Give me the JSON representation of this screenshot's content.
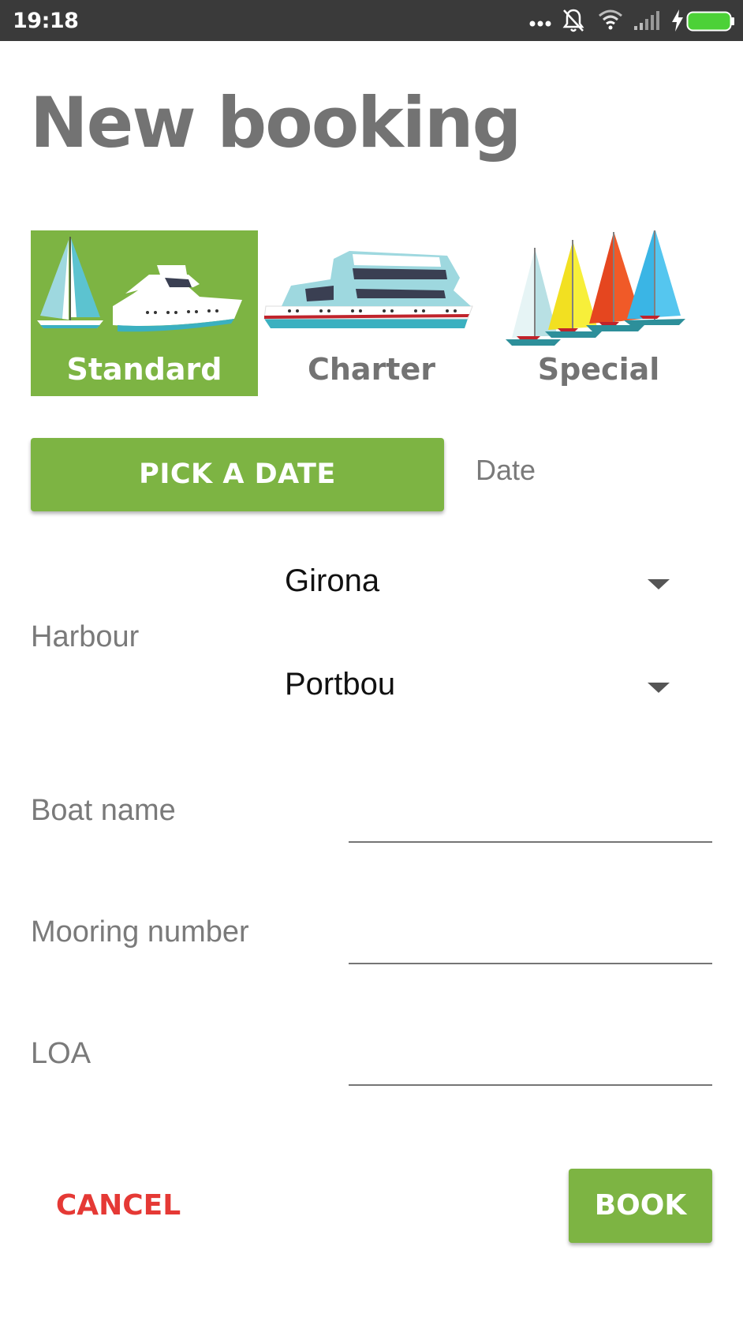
{
  "status_bar": {
    "time": "19:18",
    "icons": [
      "more-dots-icon",
      "bell-off-icon",
      "wifi-icon",
      "signal-icon",
      "charging-icon",
      "battery-icon"
    ],
    "battery_color": "#4cd137"
  },
  "title": "New booking",
  "booking_types": [
    {
      "label": "Standard",
      "icon": "sailboat-and-yacht-icon",
      "selected": true
    },
    {
      "label": "Charter",
      "icon": "charter-yacht-icon",
      "selected": false
    },
    {
      "label": "Special",
      "icon": "colorful-sailboats-icon",
      "selected": false
    }
  ],
  "date": {
    "pick_label": "PICK A DATE",
    "value_label": "Date"
  },
  "harbour": {
    "label": "Harbour",
    "region": "Girona",
    "port": "Portbou"
  },
  "fields": {
    "boat_name": {
      "label": "Boat name",
      "value": ""
    },
    "mooring_number": {
      "label": "Mooring number",
      "value": ""
    },
    "loa": {
      "label": "LOA",
      "value": ""
    }
  },
  "actions": {
    "cancel_label": "CANCEL",
    "book_label": "BOOK"
  },
  "colors": {
    "accent": "#7db443",
    "cancel": "#e53935",
    "title_gray": "#737373"
  }
}
